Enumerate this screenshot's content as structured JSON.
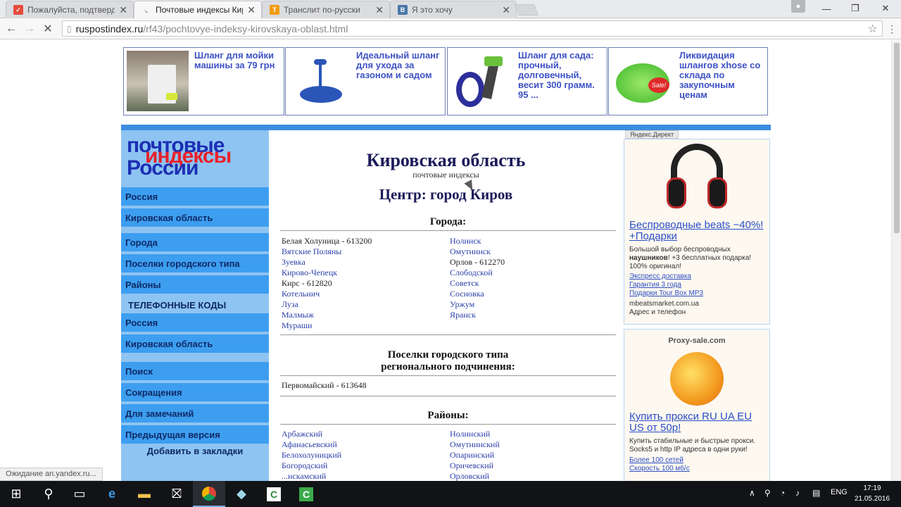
{
  "browser": {
    "tabs": [
      {
        "title": "Пожалуйста, подтверди",
        "favicon_color": "#e74c3c",
        "favicon": "pocket-icon",
        "active": false
      },
      {
        "title": "Почтовые индексы Киро",
        "favicon_color": "#777777",
        "favicon": "loading-icon",
        "active": true
      },
      {
        "title": "Транслит по-русски",
        "favicon_color": "#f39c12",
        "favicon": "translit-icon",
        "active": false
      },
      {
        "title": "Я это хочу",
        "favicon_color": "#4a76a8",
        "favicon": "vk-icon",
        "active": false
      }
    ],
    "url_host": "ruspostindex.ru",
    "url_path": "/rf43/pochtovye-indeksy-kirovskaya-oblast.html",
    "status": "Ожидание an.yandex.ru..."
  },
  "top_ads": [
    {
      "text": "Шланг для мойки машины за 79 грн"
    },
    {
      "text": "Идеальный шланг для ухода за газоном и садом"
    },
    {
      "text": "Шланг для сада: прочный, долговечный, весит 300 грамм. 95 ..."
    },
    {
      "text": "Ликвидация шлангов xhose со склада по закупочным ценам"
    }
  ],
  "logo": {
    "line1": "почтовые",
    "line2": "индексы",
    "line3": "России"
  },
  "sidebar": {
    "items": [
      {
        "label": "Россия"
      },
      {
        "label": "Кировская область"
      },
      {
        "label": "Города"
      },
      {
        "label": "Поселки городского типа"
      },
      {
        "label": "Районы"
      }
    ],
    "phone_heading": "ТЕЛЕФОННЫЕ КОДЫ",
    "phone_items": [
      {
        "label": "Россия"
      },
      {
        "label": "Кировская область"
      }
    ],
    "bottom_items": [
      {
        "label": "Поиск"
      },
      {
        "label": "Сокращения"
      },
      {
        "label": "Для замечаний"
      },
      {
        "label": "Предыдущая версия"
      }
    ],
    "bookmark": "Добавить в закладки"
  },
  "main": {
    "title": "Кировская область",
    "subtitle": "почтовые индексы",
    "center": "Центр: город Киров",
    "cities_heading": "Города:",
    "cities_left": [
      {
        "text": "Белая Холуница - 613200",
        "link": false
      },
      {
        "text": "Вятские Поляны",
        "link": true
      },
      {
        "text": "Зуевка",
        "link": true
      },
      {
        "text": "Кирово-Чепецк",
        "link": true
      },
      {
        "text": "Кирс - 612820",
        "link": false
      },
      {
        "text": "Котельнич",
        "link": true
      },
      {
        "text": "Луза",
        "link": true
      },
      {
        "text": "Малмыж",
        "link": true
      },
      {
        "text": "Мураши",
        "link": true
      }
    ],
    "cities_right": [
      {
        "text": "Нолинск",
        "link": true
      },
      {
        "text": "Омутнинск",
        "link": true
      },
      {
        "text": "Орлов - 612270",
        "link": false
      },
      {
        "text": "Слободской",
        "link": true
      },
      {
        "text": "Советск",
        "link": true
      },
      {
        "text": "Сосновка",
        "link": true
      },
      {
        "text": "Уржум",
        "link": true
      },
      {
        "text": "Яранск",
        "link": true
      }
    ],
    "settlements_heading_1": "Поселки городского типа",
    "settlements_heading_2": "регионального подчинения:",
    "settlements": [
      {
        "text": "Первомайский - 613648"
      }
    ],
    "districts_heading": "Районы:",
    "districts_left": [
      "Арбажский",
      "Афанасьевский",
      "Белохолуницкий",
      "Богородский",
      "...нскамский"
    ],
    "districts_right": [
      "Нолинский",
      "Омутнинский",
      "Опаринский",
      "Оричевский",
      "Орловский"
    ]
  },
  "right_ads": {
    "label": "Яндекс.Директ",
    "ad1": {
      "title": "Беспроводные beats −40%! +Подарки",
      "desc_pre": "Большой выбор беспроводных ",
      "desc_bold": "наушников",
      "desc_post": "! +3 бесплатных подарка! 100% оригинал!",
      "links": [
        "Экспресс доставка",
        "Гарантия 3 года",
        "Подарки Tour Box MP3"
      ],
      "domain": "mbeatsmarket.com.ua",
      "contact": "Адрес и телефон"
    },
    "ad2": {
      "brand": "Proxy-sale.com",
      "title": "Купить прокси RU UA EU US от 50р!",
      "desc": "Купить стабильные и быстрые прокси. Socks5 и http IP адреса в одни руки!",
      "links": [
        "Более 100 сетей",
        "Скорость 100 мб/с"
      ]
    }
  },
  "taskbar": {
    "lang": "ENG",
    "time": "17:19",
    "date": "21.05.2016"
  }
}
